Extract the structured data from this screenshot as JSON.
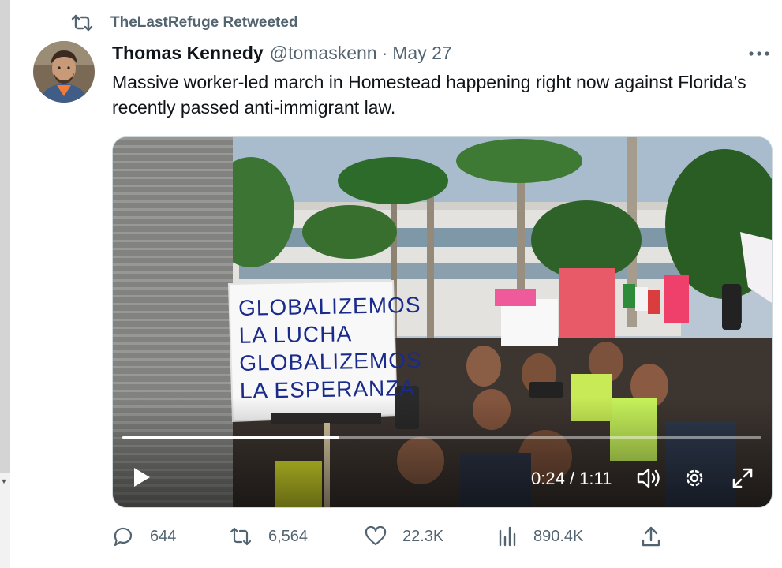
{
  "retweet_banner": {
    "icon": "retweet-icon",
    "label": "TheLastRefuge Retweeted"
  },
  "tweet": {
    "author_name": "Thomas Kennedy",
    "author_handle": "@tomaskenn",
    "separator": "·",
    "date": "May 27",
    "text": "Massive worker-led march in Homestead happening right now against Florida’s recently passed anti-immigrant law."
  },
  "media": {
    "sign_lines": [
      "GLOBALIZEMOS",
      "LA LUCHA",
      "GLOBALIZEMOS",
      "LA ESPERANZA"
    ],
    "progress_fraction": 0.34,
    "time_display": "0:24 / 1:11",
    "controls": [
      "play-icon",
      "volume-icon",
      "settings-gear-icon",
      "fullscreen-icon"
    ]
  },
  "actions": {
    "replies": "644",
    "retweets": "6,564",
    "likes": "22.3K",
    "views": "890.4K"
  },
  "colors": {
    "text_primary": "#0f1419",
    "text_secondary": "#536471"
  }
}
